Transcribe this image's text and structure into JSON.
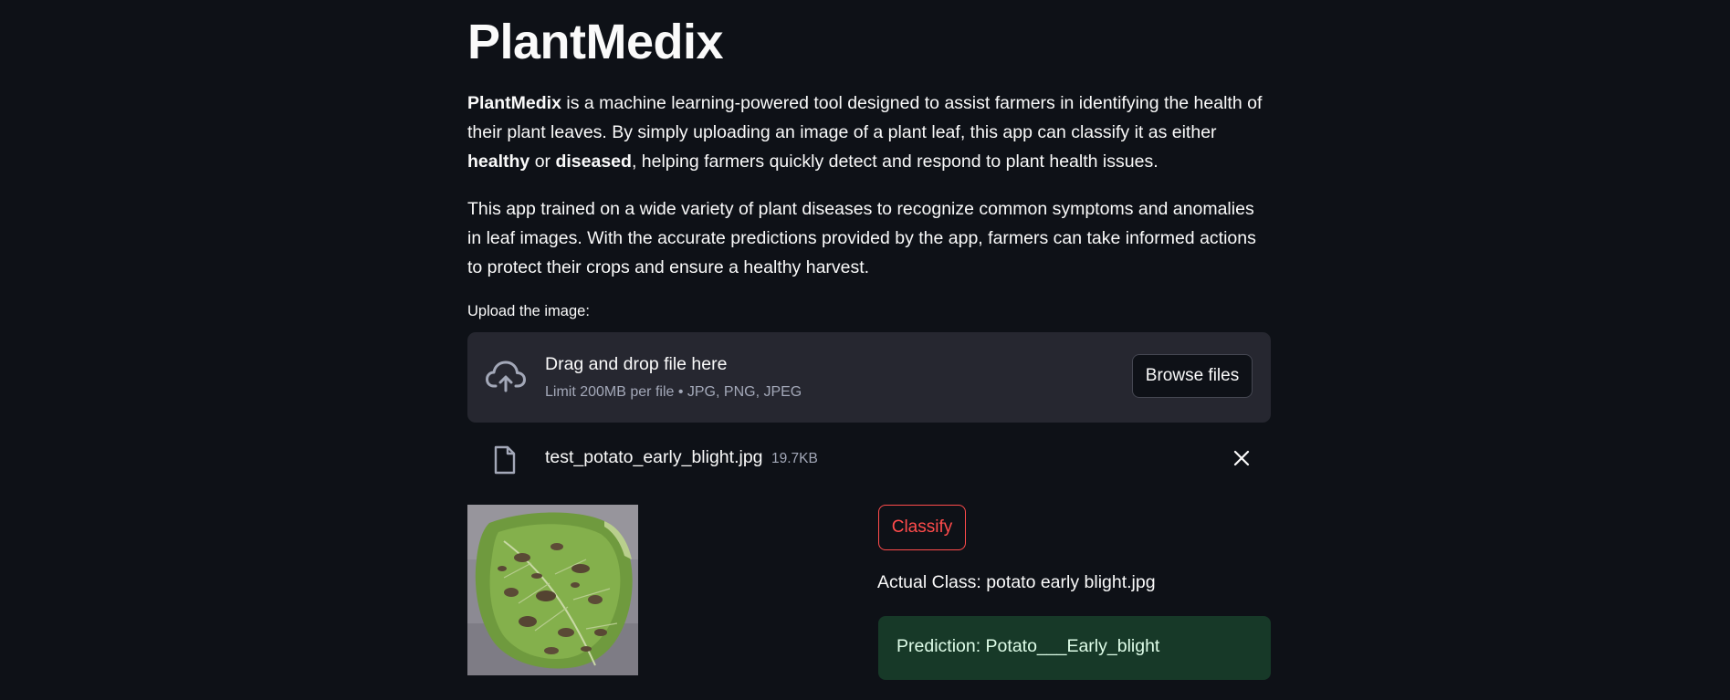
{
  "header": {
    "title": "PlantMedix"
  },
  "intro": {
    "p1_name": "PlantMedix",
    "p1_text_a": " is a machine learning-powered tool designed to assist farmers in identifying the health of their plant leaves. By simply uploading an image of a plant leaf, this app can classify it as either ",
    "p1_healthy": "healthy",
    "p1_text_b": " or ",
    "p1_diseased": "diseased",
    "p1_text_c": ", helping farmers quickly detect and respond to plant health issues.",
    "p2": "This app trained on a wide variety of plant diseases to recognize common symptoms and anomalies in leaf images. With the accurate predictions provided by the app, farmers can take informed actions to protect their crops and ensure a healthy harvest."
  },
  "uploader": {
    "label": "Upload the image:",
    "drop_title": "Drag and drop file here",
    "drop_subtitle": "Limit 200MB per file • JPG, PNG, JPEG",
    "browse_label": "Browse files",
    "icon": "cloud-upload-icon"
  },
  "uploaded_file": {
    "name": "test_potato_early_blight.jpg",
    "size": "19.7KB",
    "icon": "file-icon"
  },
  "result": {
    "classify_label": "Classify",
    "actual_class": "Actual Class: potato early blight.jpg",
    "prediction": "Prediction: Potato___Early_blight"
  },
  "colors": {
    "background": "#0e1117",
    "dropzone": "#262730",
    "accent": "#ff4b4b",
    "success_bg": "#173928",
    "success_text": "#dffde9"
  }
}
